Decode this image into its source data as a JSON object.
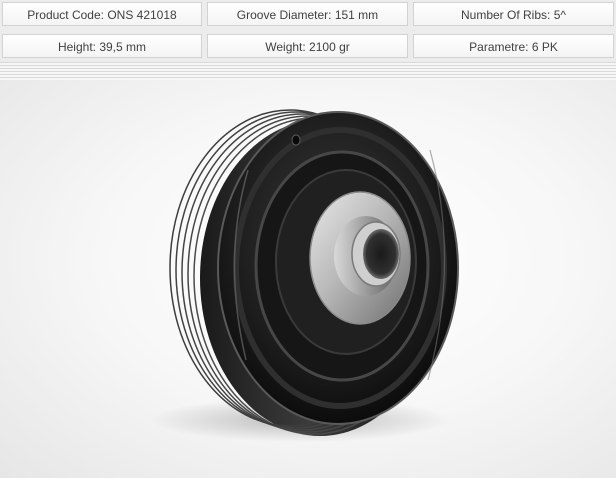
{
  "specs": {
    "product_code": "Product Code: ONS 421018",
    "groove_diameter": "Groove Diameter: 151 mm",
    "number_of_ribs": "Number Of Ribs: 5^",
    "height": "Height: 39,5 mm",
    "weight": "Weight: 2100 gr",
    "parametre": "Parametre: 6 PK"
  },
  "product_image": {
    "icon": "crankshaft-pulley-image"
  }
}
